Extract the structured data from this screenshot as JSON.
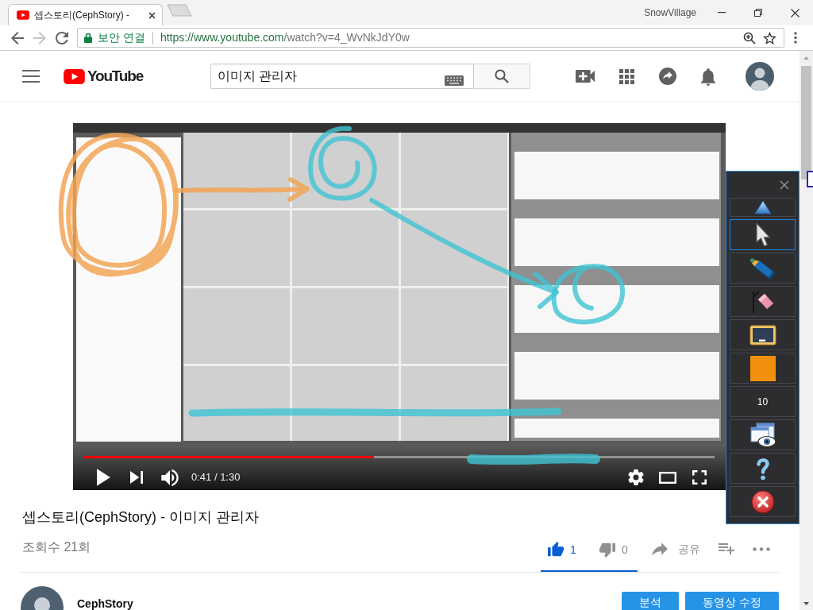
{
  "browser": {
    "tabs": [
      {
        "title": "셉스토리(CephStory) -",
        "selected": true
      }
    ],
    "profile": "SnowVillage",
    "back": {
      "disabled": false
    },
    "forward": {
      "disabled": true
    },
    "security_label": "보안 연결",
    "url": {
      "origin": "https://www.youtube.com",
      "path": "/watch?v=4_WvNkJdY0w"
    }
  },
  "header": {
    "logo": "YouTube",
    "search": {
      "value": "이미지 관리자"
    }
  },
  "player": {
    "playing": false,
    "progress": {
      "level": 0.46
    },
    "time": "0:41 / 1:30"
  },
  "video": {
    "title": "셉스토리(CephStory) - 이미지 관리자",
    "views": "조회수 21회",
    "liked": true,
    "likes": "1",
    "dislikes": "0",
    "sentiment": {
      "level": 1
    },
    "share": "공유"
  },
  "channel": {
    "name": "CephStory",
    "buttons": [
      "분석",
      "동영상 수정"
    ]
  },
  "annotation_toolbar": {
    "tools": [
      {
        "kind": "toggle",
        "selected": false
      },
      {
        "kind": "tool",
        "selected": true
      },
      {
        "kind": "tool",
        "selected": false
      },
      {
        "kind": "tool",
        "selected": false
      },
      {
        "kind": "tool",
        "selected": false
      },
      {
        "kind": "swatch",
        "color": "#f0900e",
        "selected": false
      },
      {
        "kind": "value",
        "label": "10",
        "selected": false
      },
      {
        "kind": "tool",
        "selected": false
      },
      {
        "kind": "tool",
        "selected": false
      },
      {
        "kind": "tool",
        "selected": false
      }
    ]
  }
}
